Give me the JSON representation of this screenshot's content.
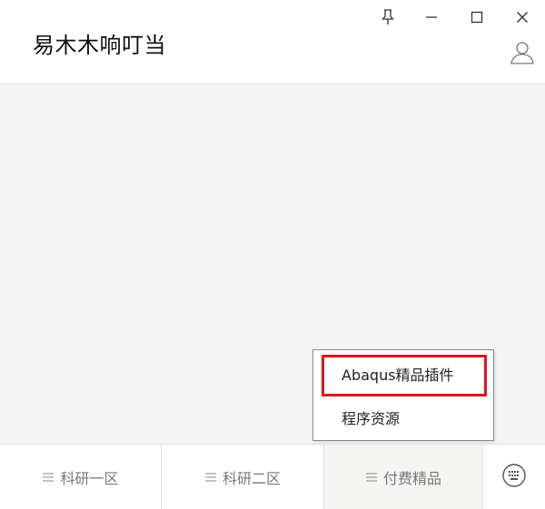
{
  "window": {
    "title": "易木木响叮当",
    "controls": [
      "pin-icon",
      "minimize-icon",
      "maximize-icon",
      "close-icon"
    ],
    "user_icon": "user-icon"
  },
  "popup_menu": {
    "items": [
      {
        "label": "Abaqus精品插件",
        "highlighted": true
      },
      {
        "label": "程序资源",
        "highlighted": false
      }
    ],
    "highlight_color": "#e0141e"
  },
  "tabbar": {
    "tabs": [
      {
        "label": "科研一区",
        "icon": "menu-lines-icon"
      },
      {
        "label": "科研二区",
        "icon": "menu-lines-icon"
      },
      {
        "label": "付费精品",
        "icon": "menu-lines-icon",
        "active": true
      }
    ],
    "keyboard_icon": "keyboard-icon"
  },
  "colors": {
    "content_bg": "#f5f5f5",
    "tab_text": "#777777",
    "active_tab_bg": "#f4f4f2"
  }
}
